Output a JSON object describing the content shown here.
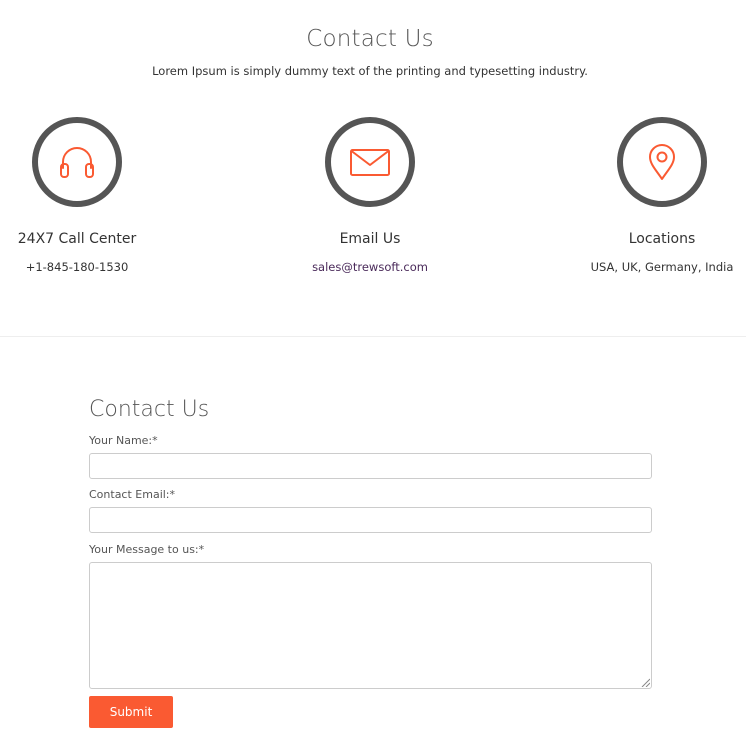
{
  "hero": {
    "title": "Contact Us",
    "subtitle": "Lorem Ipsum is simply dummy text of the printing and typesetting industry."
  },
  "cards": [
    {
      "icon": "headphones-icon",
      "title": "24X7 Call Center",
      "value": "+1-845-180-1530"
    },
    {
      "icon": "envelope-icon",
      "title": "Email Us",
      "value": "sales@trewsoft.com"
    },
    {
      "icon": "map-pin-icon",
      "title": "Locations",
      "value": "USA, UK, Germany, India"
    }
  ],
  "form": {
    "title": "Contact Us",
    "name_label": "Your Name:*",
    "name_value": "",
    "email_label": "Contact Email:*",
    "email_value": "",
    "message_label": "Your Message to us:*",
    "message_value": "",
    "submit_label": "Submit"
  },
  "colors": {
    "accent": "#fa5a32",
    "circle_border": "#555555",
    "link": "#4a2a5a"
  }
}
